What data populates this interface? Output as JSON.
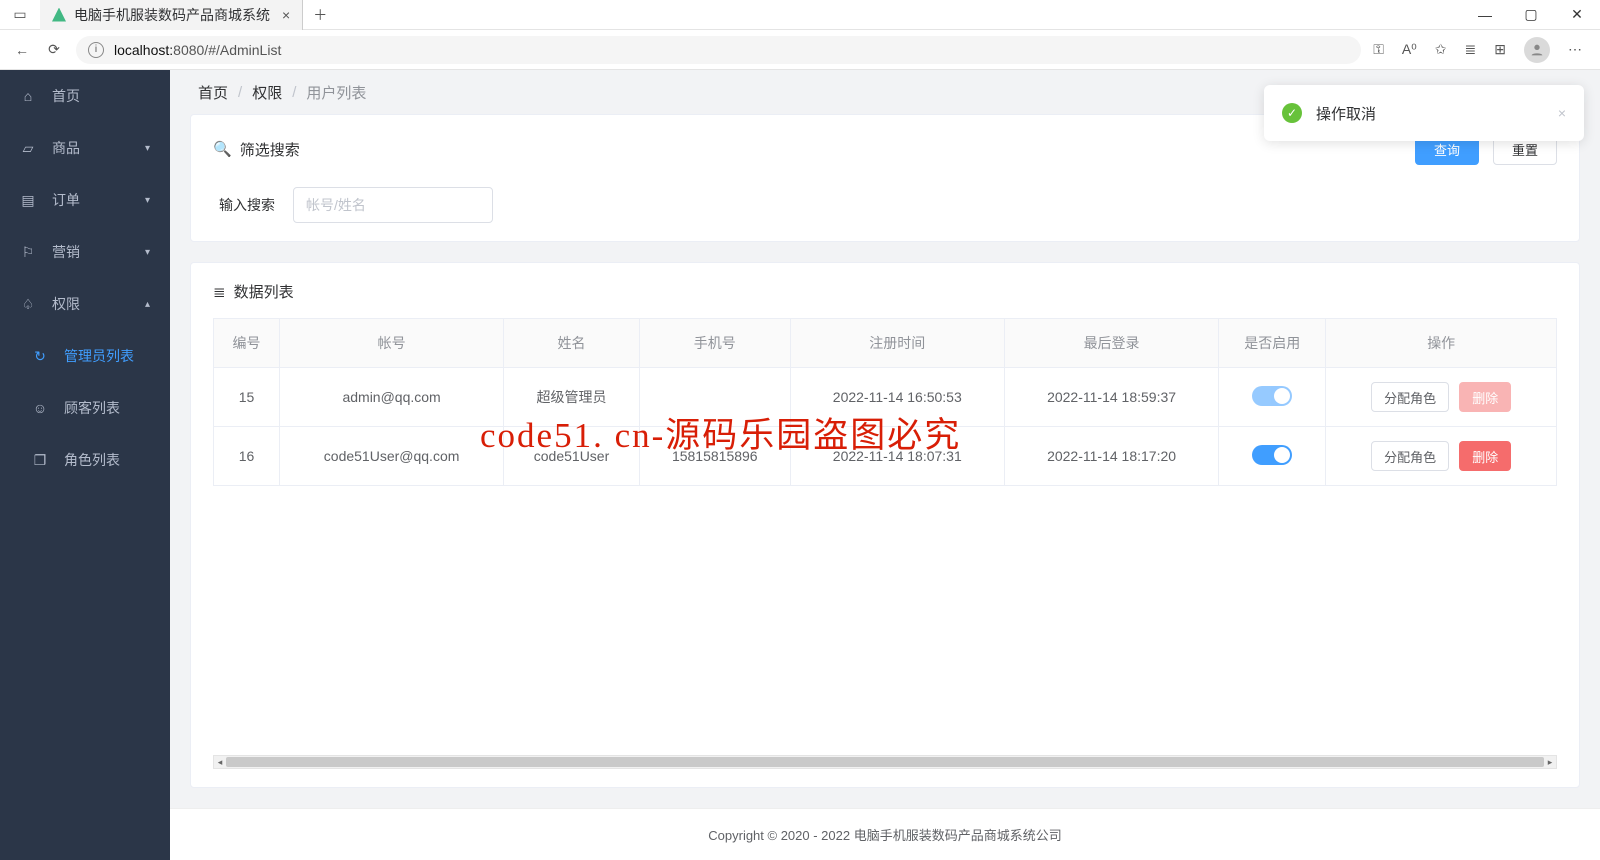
{
  "browser": {
    "tab_title": "电脑手机服装数码产品商城系统",
    "url_host": "localhost:",
    "url_rest": "8080/#/AdminList"
  },
  "sidebar": {
    "items": [
      {
        "icon": "home-icon",
        "label": "首页"
      },
      {
        "icon": "bag-icon",
        "label": "商品",
        "arrow": "▾"
      },
      {
        "icon": "clipboard-icon",
        "label": "订单",
        "arrow": "▾"
      },
      {
        "icon": "promo-icon",
        "label": "营销",
        "arrow": "▾"
      },
      {
        "icon": "bell-icon",
        "label": "权限",
        "arrow": "▴"
      },
      {
        "icon": "refresh-icon",
        "label": "管理员列表",
        "active": true
      },
      {
        "icon": "user-icon",
        "label": "顾客列表"
      },
      {
        "icon": "cube-icon",
        "label": "角色列表"
      }
    ]
  },
  "breadcrumb": {
    "a": "首页",
    "b": "权限",
    "c": "用户列表"
  },
  "filter": {
    "title": "筛选搜索",
    "input_label": "输入搜索",
    "placeholder": "帐号/姓名",
    "query_btn": "查询",
    "reset_btn": "重置"
  },
  "list": {
    "title": "数据列表",
    "headers": {
      "id": "编号",
      "account": "帐号",
      "name": "姓名",
      "phone": "手机号",
      "reg": "注册时间",
      "last": "最后登录",
      "enabled": "是否启用",
      "ops": "操作"
    },
    "assign_btn": "分配角色",
    "delete_btn": "删除",
    "rows": [
      {
        "id": "15",
        "account": "admin@qq.com",
        "name": "超级管理员",
        "phone": " ",
        "reg": "2022-11-14 16:50:53",
        "last": "2022-11-14 18:59:37",
        "light": true
      },
      {
        "id": "16",
        "account": "code51User@qq.com",
        "name": "code51User",
        "phone": "15815815896",
        "reg": "2022-11-14 18:07:31",
        "last": "2022-11-14 18:17:20",
        "light": false
      }
    ]
  },
  "toast": {
    "msg": "操作取消"
  },
  "footer": "Copyright © 2020 - 2022    电脑手机服装数码产品商城系统公司",
  "watermark": "code51. cn-源码乐园盗图必究"
}
